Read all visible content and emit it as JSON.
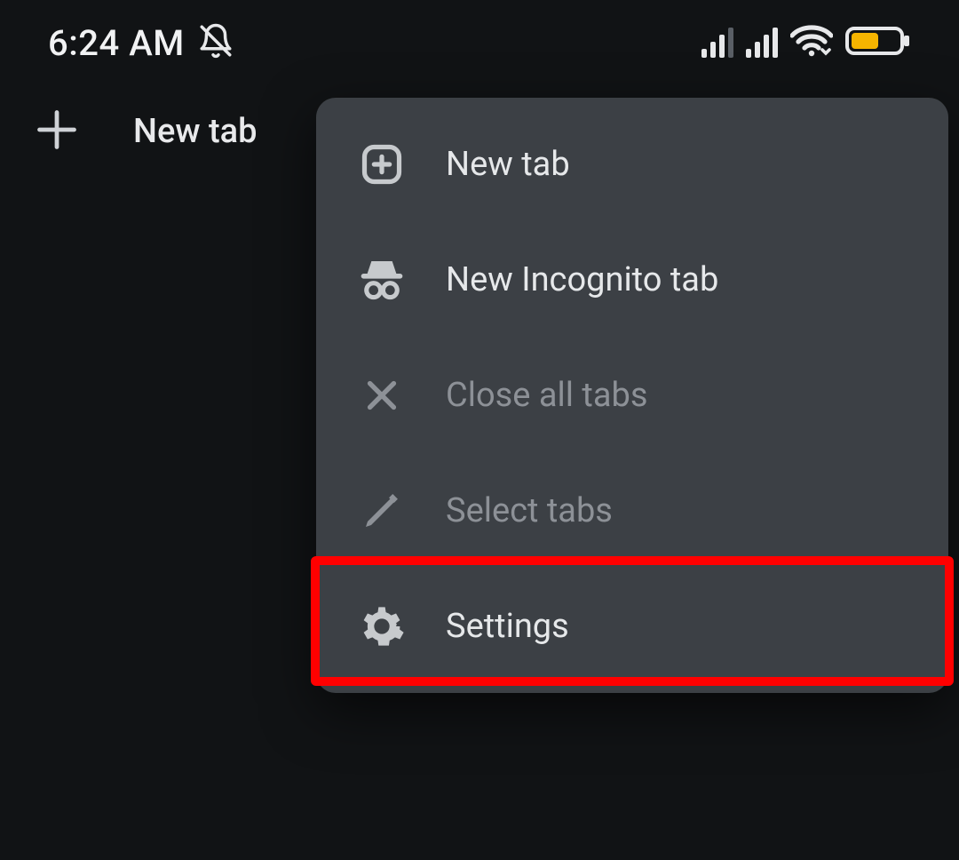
{
  "status": {
    "time": "6:24 AM",
    "dnd_icon": "bell-off-icon",
    "signal1_bars": 3,
    "signal2_bars": 4,
    "wifi_icon": "wifi-icon",
    "battery_color": "#f5b400"
  },
  "toolbar": {
    "new_tab_label": "New tab"
  },
  "menu": {
    "items": [
      {
        "key": "new-tab",
        "label": "New tab",
        "icon": "plus-square-icon",
        "enabled": true
      },
      {
        "key": "incognito",
        "label": "New Incognito tab",
        "icon": "incognito-icon",
        "enabled": true
      },
      {
        "key": "close-all",
        "label": "Close all tabs",
        "icon": "close-icon",
        "enabled": false
      },
      {
        "key": "select-tabs",
        "label": "Select tabs",
        "icon": "pencil-icon",
        "enabled": false
      },
      {
        "key": "settings",
        "label": "Settings",
        "icon": "gear-icon",
        "enabled": true
      }
    ],
    "highlighted_key": "settings"
  }
}
